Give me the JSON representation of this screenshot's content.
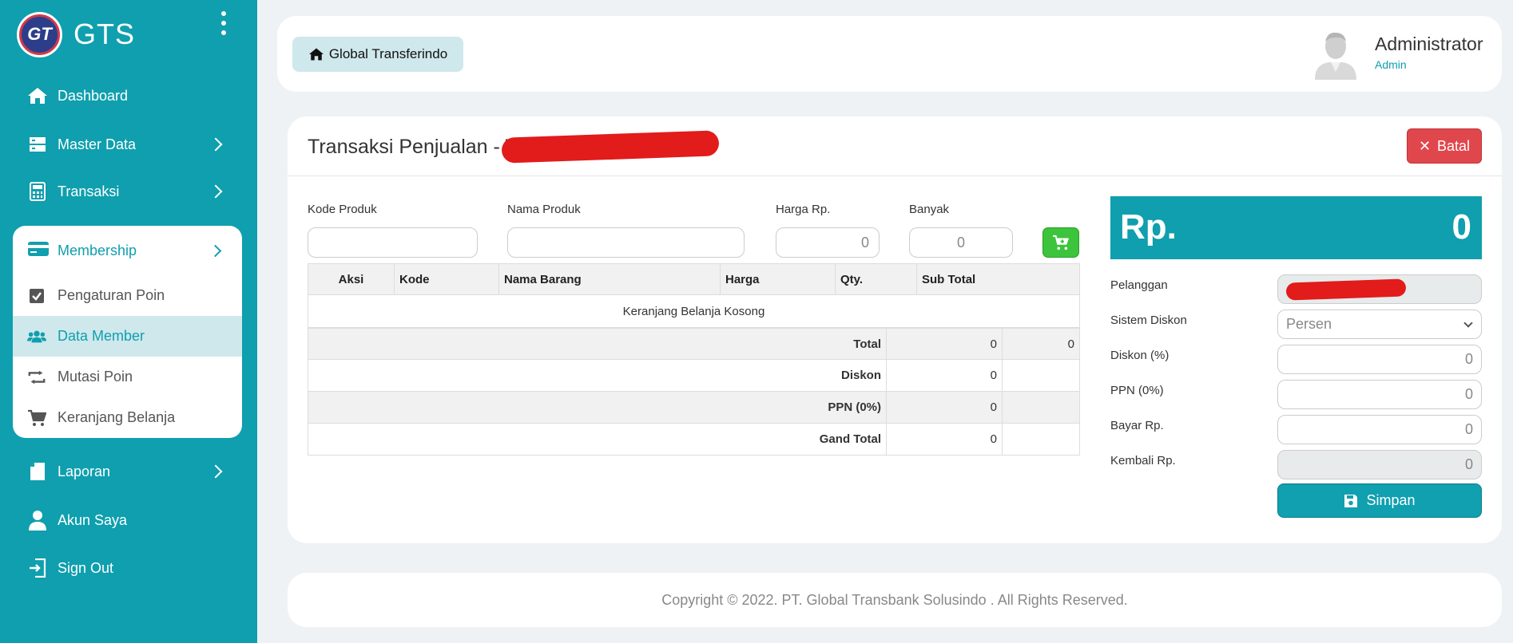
{
  "brand": {
    "logo_text": "GT",
    "name": "GTS"
  },
  "nav": {
    "dashboard": "Dashboard",
    "master_data": "Master Data",
    "transaksi": "Transaksi",
    "membership": "Membership",
    "membership_items": [
      "Pengaturan Poin",
      "Data Member",
      "Mutasi Poin",
      "Keranjang Belanja"
    ],
    "laporan": "Laporan",
    "akun_saya": "Akun Saya",
    "sign_out": "Sign Out"
  },
  "header": {
    "home_label": "Global Transferindo",
    "user_name": "Administrator",
    "user_role": "Admin"
  },
  "card": {
    "title": "Transaksi Penjualan - T",
    "cancel_label": "Batal"
  },
  "form": {
    "kode_label": "Kode Produk",
    "nama_label": "Nama Produk",
    "harga_label": "Harga Rp.",
    "banyak_label": "Banyak",
    "harga_value": "0",
    "banyak_value": "0"
  },
  "table": {
    "headers": [
      "Aksi",
      "Kode",
      "Nama Barang",
      "Harga",
      "Qty.",
      "Sub Total"
    ],
    "empty_text": "Keranjang Belanja Kosong",
    "summary": [
      {
        "label": "Total",
        "value": "0",
        "value2": "0"
      },
      {
        "label": "Diskon",
        "value": "0",
        "value2": ""
      },
      {
        "label": "PPN (0%)",
        "value": "0",
        "value2": ""
      },
      {
        "label": "Gand Total",
        "value": "0",
        "value2": ""
      }
    ]
  },
  "panel": {
    "currency": "Rp.",
    "amount": "0",
    "pelanggan_label": "Pelanggan",
    "sistem_diskon_label": "Sistem Diskon",
    "sistem_diskon_value": "Persen",
    "diskon_label": "Diskon (%)",
    "diskon_value": "0",
    "ppn_label": "PPN (0%)",
    "ppn_value": "0",
    "bayar_label": "Bayar Rp.",
    "bayar_value": "0",
    "kembali_label": "Kembali Rp.",
    "kembali_value": "0",
    "save_label": "Simpan"
  },
  "footer": {
    "copyright": "Copyright © 2022. PT. Global Transbank Solusindo . All Rights Reserved."
  },
  "colors": {
    "primary": "#0f9fae",
    "danger": "#e0474c",
    "success": "#3cc43c"
  }
}
